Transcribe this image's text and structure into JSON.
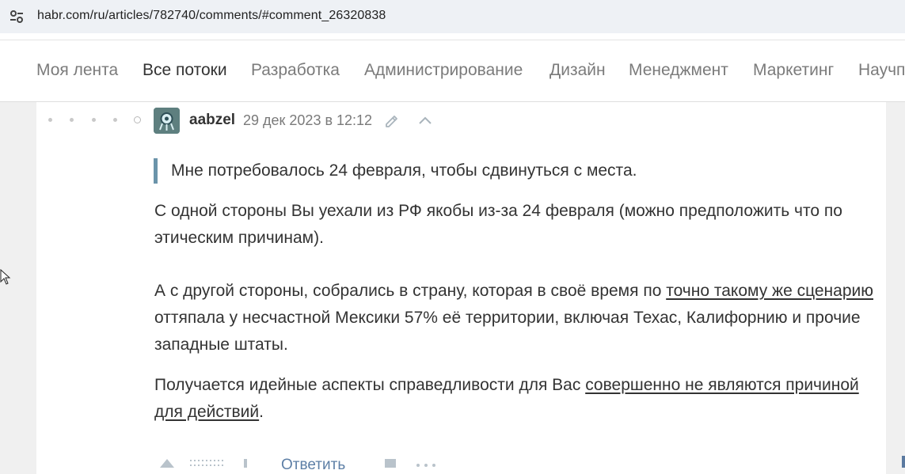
{
  "browser": {
    "url": "habr.com/ru/articles/782740/comments/#comment_26320838",
    "site_icon": "tune-icon"
  },
  "nav": {
    "items": [
      {
        "label": "Моя лента",
        "active": false
      },
      {
        "label": "Все потоки",
        "active": true
      },
      {
        "label": "Разработка",
        "active": false
      },
      {
        "label": "Администрирование",
        "active": false
      },
      {
        "label": "Дизайн",
        "active": false
      },
      {
        "label": "Менеджмент",
        "active": false
      },
      {
        "label": "Маркетинг",
        "active": false
      },
      {
        "label": "Научп",
        "active": false
      }
    ]
  },
  "comment": {
    "username": "aabzel",
    "date": "29 дек 2023 в 12:12",
    "quote": "Мне потребовалось 24 февраля, чтобы сдвинуться с места.",
    "paragraph1": "С одной стороны Вы уехали из РФ якобы из-за 24 февраля (можно предположить что по этическим причинам).",
    "paragraph2_before": "А с другой стороны, собрались в страну, которая в своё время по ",
    "paragraph2_link": "точно такому же сценарию",
    "paragraph2_after": " оттяпала у несчастной Мексики 57% её территории, включая Техас, Калифорнию и прочие западные штаты.",
    "paragraph3_before": "Получается идейные аспекты справедливости для Вас ",
    "paragraph3_link": "совершенно не являются причиной для действий",
    "paragraph3_after": ".",
    "reply_label": "Ответить",
    "accent_color": "#6b94aa"
  }
}
